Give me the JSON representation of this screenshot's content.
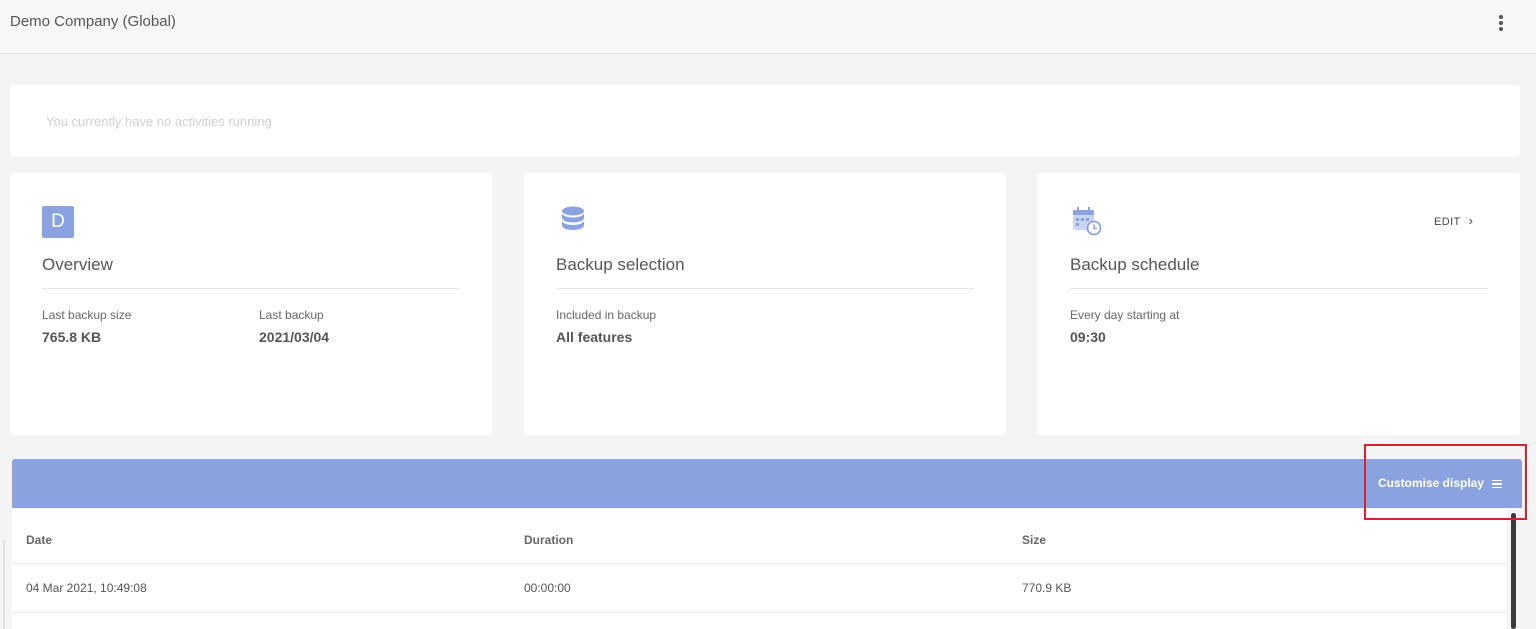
{
  "header": {
    "company": "Demo Company (Global)",
    "menu_icon": "kebab-vertical-icon"
  },
  "activity": {
    "message": "You currently have no activities running"
  },
  "cards": {
    "overview": {
      "icon_letter": "D",
      "title": "Overview",
      "last_backup_size_label": "Last backup size",
      "last_backup_size": "765.8 KB",
      "last_backup_label": "Last backup",
      "last_backup": "2021/03/04"
    },
    "selection": {
      "icon": "database-icon",
      "title": "Backup selection",
      "included_label": "Included in backup",
      "included": "All features"
    },
    "schedule": {
      "icon": "calendar-clock-icon",
      "title": "Backup schedule",
      "edit_label": "EDIT",
      "frequency_label": "Every day starting at",
      "time": "09:30"
    }
  },
  "table": {
    "customise_label": "Customise display",
    "columns": [
      "Date",
      "Duration",
      "Size"
    ],
    "rows": [
      {
        "date": "04 Mar 2021, 10:49:08",
        "duration": "00:00:00",
        "size": "770.9 KB"
      }
    ]
  },
  "colors": {
    "accent": "#8aa3e0",
    "highlight": "#d9202e"
  }
}
